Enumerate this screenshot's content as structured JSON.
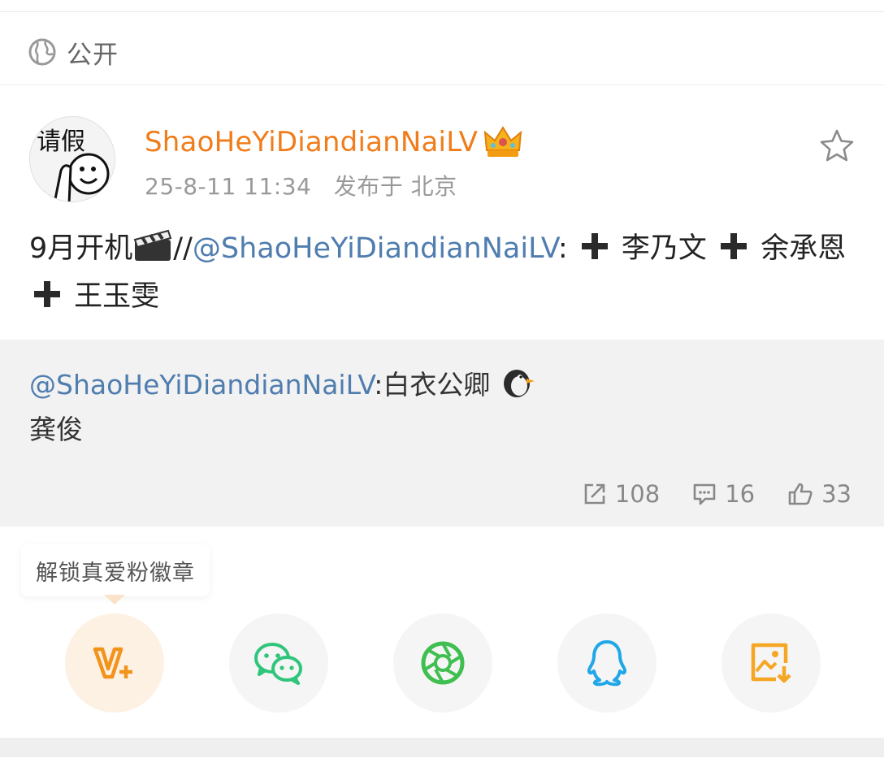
{
  "visibility": {
    "label": "公开",
    "icon": "globe-icon"
  },
  "post": {
    "author": "ShaoHeYiDiandianNaiLV",
    "author_badge_icon": "crown-vip-icon",
    "avatar_text": "请假",
    "time": "25-8-11 11:34",
    "location": "发布于 北京",
    "text_prefix": "9月开机",
    "text_sep": "//",
    "mention": "@ShaoHeYiDiandianNaiLV",
    "text_rest": ":",
    "names": [
      "李乃文",
      "余承恩",
      "王玉雯"
    ],
    "favorite_icon": "star-icon"
  },
  "repost": {
    "mention": "@ShaoHeYiDiandianNaiLV",
    "text": ":白衣公卿",
    "second_line": "龚俊",
    "stats": {
      "reposts": "108",
      "comments": "16",
      "likes": "33"
    }
  },
  "share": {
    "tip": "解锁真爱粉徽章",
    "buttons": [
      {
        "name": "vip-share",
        "icon": "vip-plus-icon"
      },
      {
        "name": "wechat",
        "icon": "wechat-icon"
      },
      {
        "name": "moments",
        "icon": "moments-aperture-icon"
      },
      {
        "name": "qq",
        "icon": "qq-penguin-icon"
      },
      {
        "name": "save-image",
        "icon": "save-image-icon"
      }
    ]
  },
  "colors": {
    "username": "#f07c1a",
    "mention": "#507daf",
    "repost_bg": "#f2f2f2",
    "wechat": "#2fc57a",
    "moments": "#3fbf4f",
    "qq": "#1fa7e8",
    "save": "#f5a623"
  }
}
